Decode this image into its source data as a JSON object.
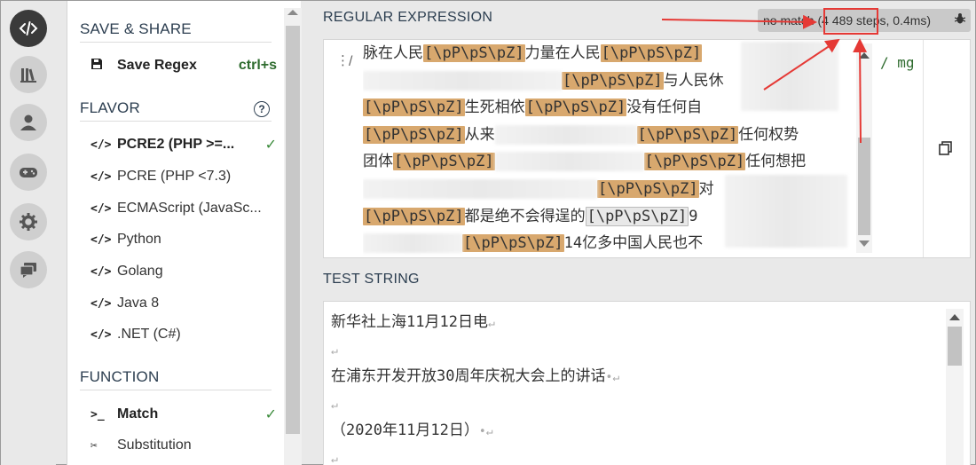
{
  "icons": {
    "regex": "code-icon",
    "library": "library-icon",
    "account": "user-icon",
    "quiz": "gamepad-icon",
    "settings": "gear-icon",
    "chat": "chat-icon"
  },
  "colors": {
    "accent": "#2c3e50",
    "match": "#d8a86e",
    "check": "#3a8a3a",
    "annotation": "#e53935"
  },
  "sidebar": {
    "save_share_title": "SAVE & SHARE",
    "save_label": "Save Regex",
    "save_shortcut": "ctrl+s",
    "flavor_title": "FLAVOR",
    "help_glyph": "?",
    "flavors": [
      "PCRE2 (PHP >=...",
      "PCRE (PHP <7.3)",
      "ECMAScript (JavaSc...",
      "Python",
      "Golang",
      "Java 8",
      ".NET (C#)"
    ],
    "function_title": "FUNCTION",
    "functions": [
      "Match",
      "Substitution"
    ],
    "check_glyph": "✓"
  },
  "regex": {
    "title": "REGULAR EXPRESSION",
    "status": "no match (4 489 steps, 0.4ms)",
    "drag_glyph": "⋮",
    "slash": "/",
    "flags": "/ mg",
    "token": "[\\pP\\pS\\pZ]",
    "lines": [
      [
        "脉在人民",
        "力量在人民"
      ],
      [
        "",
        "与人民休"
      ],
      [
        "",
        "生死相依",
        "没有任何自"
      ],
      [
        "",
        "从来",
        "任何权势"
      ],
      [
        "团体",
        "任何想把"
      ],
      [
        "对"
      ],
      [
        "",
        "都是绝不会得逞的",
        "9"
      ],
      [
        "",
        "14亿多中国人民也不"
      ]
    ]
  },
  "test": {
    "title": "TEST STRING",
    "return_glyph": "↵",
    "dot_glyph": "•",
    "lines": [
      "新华社上海11月12日电",
      "",
      "在浦东开发开放30周年庆祝大会上的讲话",
      "",
      "（2020年11月12日）",
      ""
    ]
  }
}
